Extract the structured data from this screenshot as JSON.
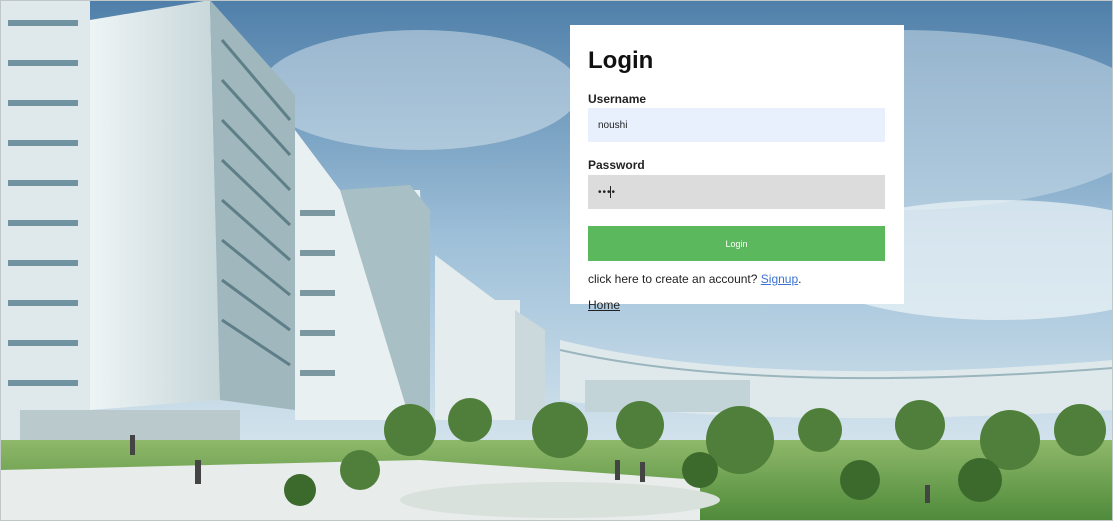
{
  "login": {
    "title": "Login",
    "username_label": "Username",
    "username_value": "noushi",
    "password_label": "Password",
    "password_value": "••••",
    "button_label": "Login",
    "signup_prompt": "click here to create an account?",
    "signup_link": "Signup",
    "signup_period": "."
  },
  "nav": {
    "home_link": "Home"
  },
  "colors": {
    "button_green": "#5cb85c",
    "username_bg": "#e8f0fe",
    "password_bg": "#dcdcdc",
    "link_blue": "#3b73d4"
  }
}
